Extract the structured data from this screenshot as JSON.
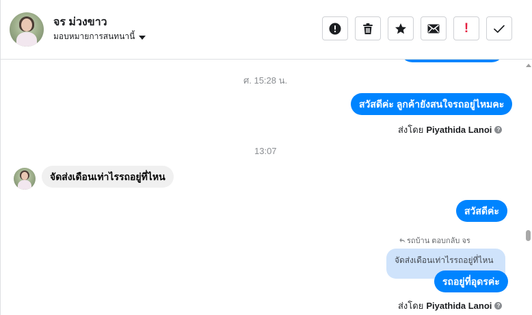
{
  "header": {
    "contact_name": "จร ม่วงขาว",
    "assign_label": "มอบหมายการสนทนานี้",
    "toolbar": [
      {
        "name": "spam-button",
        "icon": "alert-circle-icon"
      },
      {
        "name": "delete-button",
        "icon": "trash-icon"
      },
      {
        "name": "star-button",
        "icon": "star-icon"
      },
      {
        "name": "mark-unread-button",
        "icon": "envelope-icon"
      },
      {
        "name": "follow-up-button",
        "icon": "exclamation-icon"
      },
      {
        "name": "mark-done-button",
        "icon": "checkmark-icon"
      }
    ],
    "exclamation_glyph": "!"
  },
  "thread": {
    "stamp1": "ศ. 15:28 น.",
    "msg1": "สวัสดีค่ะ ลูกค้ายังสนใจรถอยู่ไหมคะ",
    "sentby_prefix": "ส่งโดย",
    "sentby_name": "Piyathida Lanoi",
    "info_glyph": "?",
    "stamp2": "13:07",
    "msg_in": "จัดส่งเดือนเท่าไรรถอยู่ที่ไหน",
    "msg2": "สวัสดีค่ะ",
    "reply_note": "รถบ้าน ตอบกลับ จร",
    "quoted_text": "จัดส่งเดือนเท่าไรรถอยู่ที่ไหน",
    "msg3": "รถอยู่ที่อุดรค่ะ"
  },
  "colors": {
    "outgoing_bubble": "#0084ff",
    "incoming_bubble": "#f0f0f0",
    "quote_bubble": "#cfe3fb",
    "follow_up_red": "#e41e3f"
  }
}
